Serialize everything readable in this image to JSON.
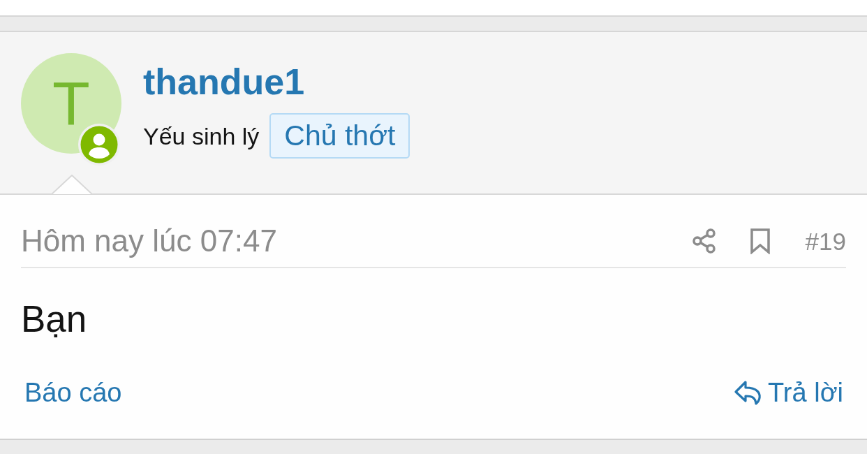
{
  "post": {
    "author": {
      "avatar_letter": "T",
      "online": true,
      "username": "thandue1",
      "title": "Yếu sinh lý",
      "badge": "Chủ thớt"
    },
    "date": "Hôm nay lúc 07:47",
    "number": "#19",
    "body": "Bạn",
    "actions": [
      {
        "label": "Báo cáo",
        "kind": "report"
      },
      {
        "label": "Trả lời",
        "kind": "reply"
      }
    ]
  }
}
